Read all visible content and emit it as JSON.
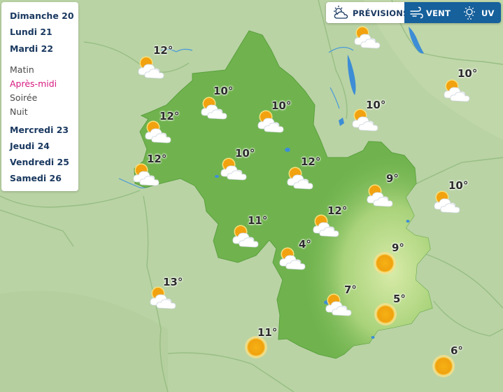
{
  "days": {
    "dimanche": "Dimanche 20",
    "lundi": "Lundi 21",
    "mardi": "Mardi 22",
    "mercredi": "Mercredi 23",
    "jeudi": "Jeudi 24",
    "vendredi": "Vendredi 25",
    "samedi": "Samedi 26"
  },
  "periods": {
    "matin": "Matin",
    "apres_midi": "Après-midi",
    "soiree": "Soirée",
    "nuit": "Nuit",
    "selected": "Après-midi"
  },
  "tabs": {
    "forecast": "PRÉVISIONS",
    "wind": "VENT",
    "uv": "UV",
    "active": "PRÉVISIONS"
  },
  "colors": {
    "region": "#6fb24e",
    "mountains": "#b9dc86",
    "background": "#b9d3a4",
    "water": "#3d8dd6",
    "sun": "#f3a712",
    "accent": "#d6177f",
    "tab_active_bg": "#ffffff",
    "tab_bg": "#16609c"
  },
  "forecast": {
    "t1": {
      "temp": "12°",
      "icon": "sun-cloud-icon"
    },
    "t2": {
      "temp": "10°",
      "icon": "sun-cloud-icon"
    },
    "t3": {
      "temp": "10°",
      "icon": "sun-cloud-icon"
    },
    "t4": {
      "temp": "10°",
      "icon": "sun-cloud-icon"
    },
    "t5": {
      "temp": "10°",
      "icon": "sun-cloud-icon"
    },
    "t6": {
      "temp": "12°",
      "icon": "sun-cloud-icon"
    },
    "t7": {
      "temp": "12°",
      "icon": "sun-cloud-icon"
    },
    "t8": {
      "temp": "10°",
      "icon": "sun-cloud-icon"
    },
    "t9": {
      "temp": "12°",
      "icon": "sun-cloud-icon"
    },
    "t10": {
      "temp": "9°",
      "icon": "sun-cloud-icon"
    },
    "t11": {
      "temp": "10°",
      "icon": "sun-cloud-icon"
    },
    "t12": {
      "temp": "12°",
      "icon": "sun-cloud-icon"
    },
    "t13": {
      "temp": "11°",
      "icon": "sun-cloud-icon"
    },
    "t14": {
      "temp": "4°",
      "icon": "sun-cloud-icon"
    },
    "t15": {
      "temp": "9°",
      "icon": "sun-icon"
    },
    "t16": {
      "temp": "13°",
      "icon": "sun-cloud-icon"
    },
    "t17": {
      "temp": "7°",
      "icon": "sun-cloud-icon"
    },
    "t18": {
      "temp": "5°",
      "icon": "sun-icon"
    },
    "t19": {
      "temp": "11°",
      "icon": "sun-icon"
    },
    "t20": {
      "temp": "6°",
      "icon": "sun-icon"
    }
  }
}
